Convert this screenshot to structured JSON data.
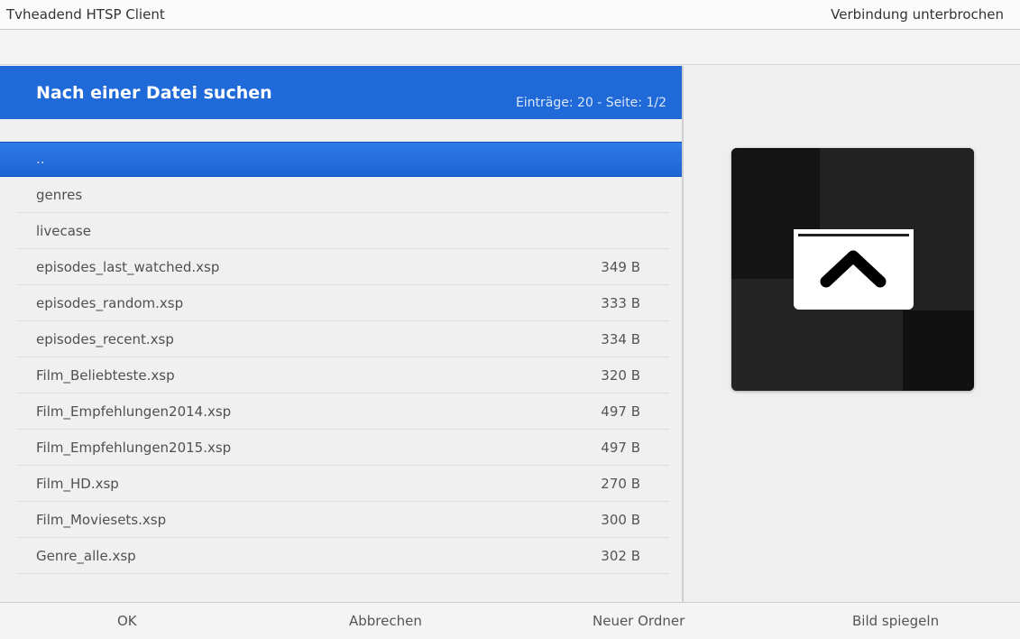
{
  "app": {
    "title": "Tvheadend HTSP Client",
    "status": "Verbindung unterbrochen"
  },
  "dialog": {
    "title": "Nach einer Datei suchen",
    "counts": "Einträge: 20 - Seite: 1/2"
  },
  "files": [
    {
      "name": "..",
      "size": "",
      "selected": true
    },
    {
      "name": "genres",
      "size": ""
    },
    {
      "name": "livecase",
      "size": ""
    },
    {
      "name": "episodes_last_watched.xsp",
      "size": "349 B"
    },
    {
      "name": "episodes_random.xsp",
      "size": "333 B"
    },
    {
      "name": "episodes_recent.xsp",
      "size": "334 B"
    },
    {
      "name": "Film_Beliebteste.xsp",
      "size": "320 B"
    },
    {
      "name": "Film_Empfehlungen2014.xsp",
      "size": "497 B"
    },
    {
      "name": "Film_Empfehlungen2015.xsp",
      "size": "497 B"
    },
    {
      "name": "Film_HD.xsp",
      "size": "270 B"
    },
    {
      "name": "Film_Moviesets.xsp",
      "size": "300 B"
    },
    {
      "name": "Genre_alle.xsp",
      "size": "302 B"
    }
  ],
  "preview": {
    "icon": "folder-up-icon"
  },
  "buttons": {
    "ok": "OK",
    "cancel": "Abbrechen",
    "new_folder": "Neuer Ordner",
    "mirror": "Bild spiegeln"
  },
  "colors": {
    "accent": "#1f6ad8",
    "background": "#f0f0f0"
  }
}
